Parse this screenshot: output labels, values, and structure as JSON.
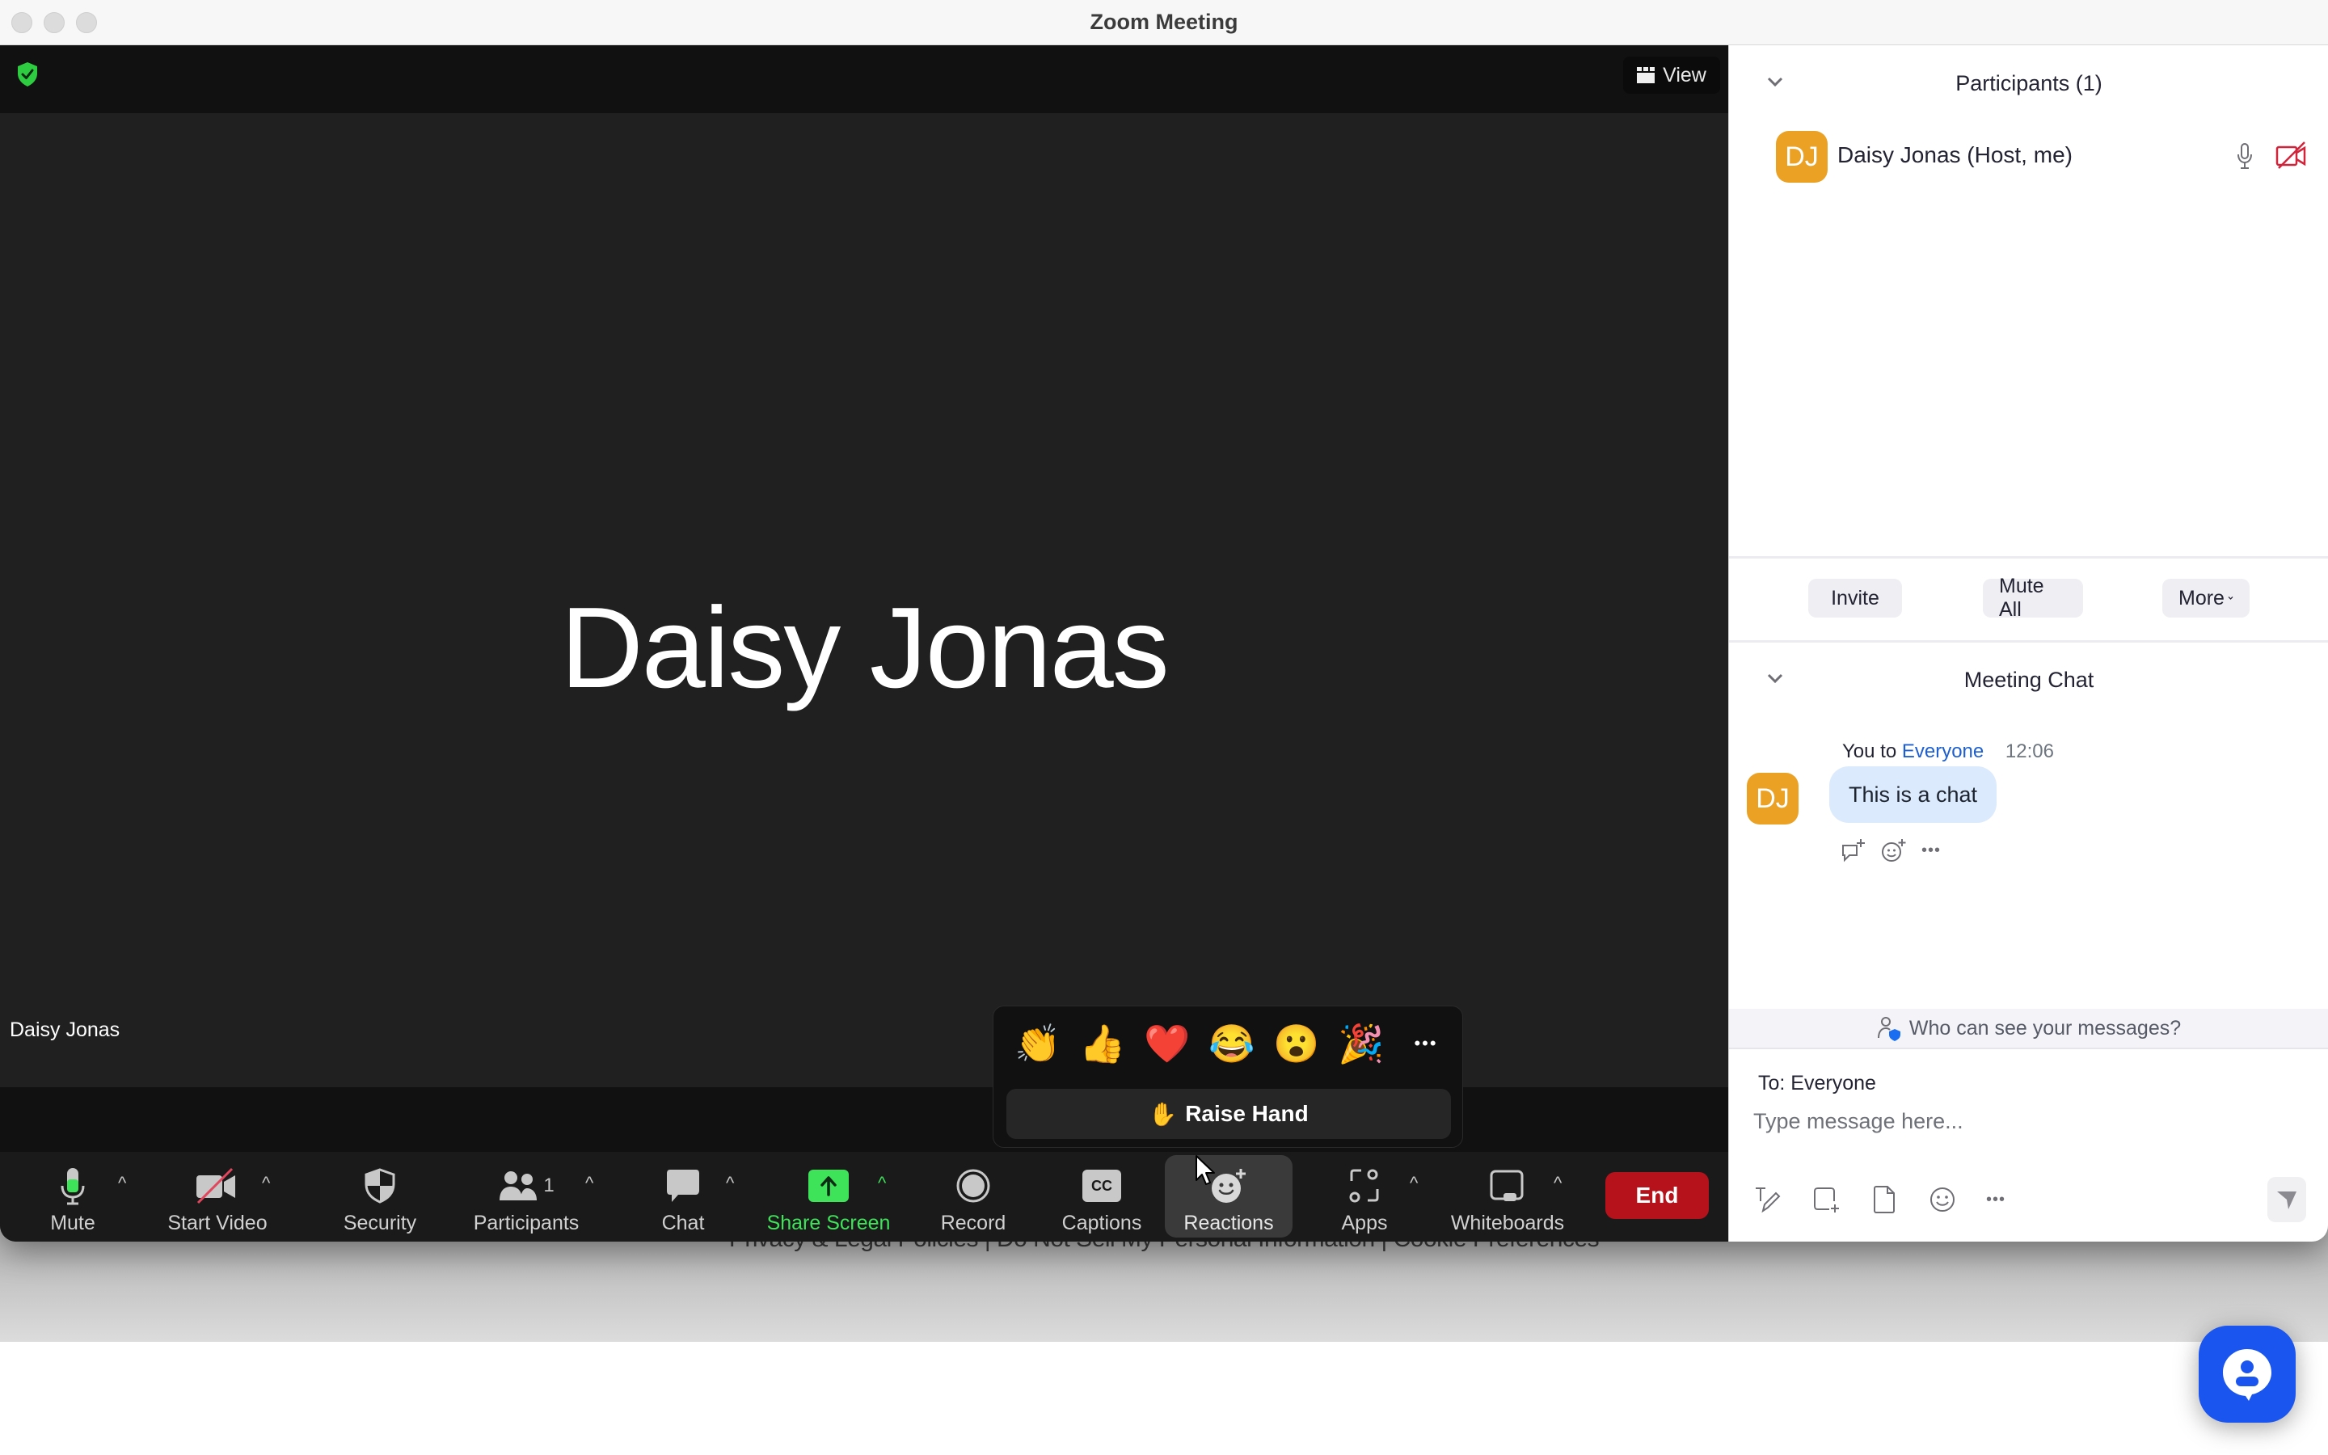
{
  "window": {
    "title": "Zoom Meeting"
  },
  "video": {
    "view_label": "View",
    "participant_display_name": "Daisy Jonas",
    "name_tag": "Daisy Jonas"
  },
  "reactions_popup": {
    "emojis": [
      {
        "name": "clap",
        "glyph": "👏"
      },
      {
        "name": "thumbs-up",
        "glyph": "👍"
      },
      {
        "name": "heart",
        "glyph": "❤️"
      },
      {
        "name": "joy",
        "glyph": "😂"
      },
      {
        "name": "open-mouth",
        "glyph": "😮"
      },
      {
        "name": "party-popper",
        "glyph": "🎉"
      }
    ],
    "more_glyph": "•••",
    "raise_hand_glyph": "✋",
    "raise_hand_label": "Raise Hand"
  },
  "toolbar": {
    "mute_label": "Mute",
    "start_video_label": "Start Video",
    "security_label": "Security",
    "participants_label": "Participants",
    "participants_count": "1",
    "chat_label": "Chat",
    "share_screen_label": "Share Screen",
    "record_label": "Record",
    "captions_label": "Captions",
    "captions_glyph": "CC",
    "reactions_label": "Reactions",
    "apps_label": "Apps",
    "whiteboards_label": "Whiteboards",
    "end_label": "End",
    "caret_glyph": "^"
  },
  "participants_panel": {
    "title": "Participants (1)",
    "participants": [
      {
        "initials": "DJ",
        "name": "Daisy Jonas (Host, me)",
        "mic": "on",
        "video": "off"
      }
    ],
    "buttons": {
      "invite": "Invite",
      "mute_all": "Mute All",
      "more": "More"
    }
  },
  "chat_panel": {
    "title": "Meeting Chat",
    "messages": [
      {
        "initials": "DJ",
        "sender": "You",
        "to_word": "to",
        "recipient": "Everyone",
        "time": "12:06",
        "text": "This is a chat"
      }
    ],
    "privacy_text": "Who can see your messages?",
    "to_label": "To: Everyone",
    "input_placeholder": "Type message here...",
    "input_value": ""
  },
  "page_footer": {
    "text": "Privacy & Legal Policies | Do Not Sell My Personal Information | Cookie Preferences"
  },
  "colors": {
    "share_screen_green": "#3ee35a",
    "end_red": "#b5121b",
    "avatar_orange": "#eba124",
    "link_blue": "#1e5fcf",
    "bubble_blue": "#dbeafc",
    "video_off_red": "#d0243b",
    "support_bot_blue": "#1a55f0"
  }
}
